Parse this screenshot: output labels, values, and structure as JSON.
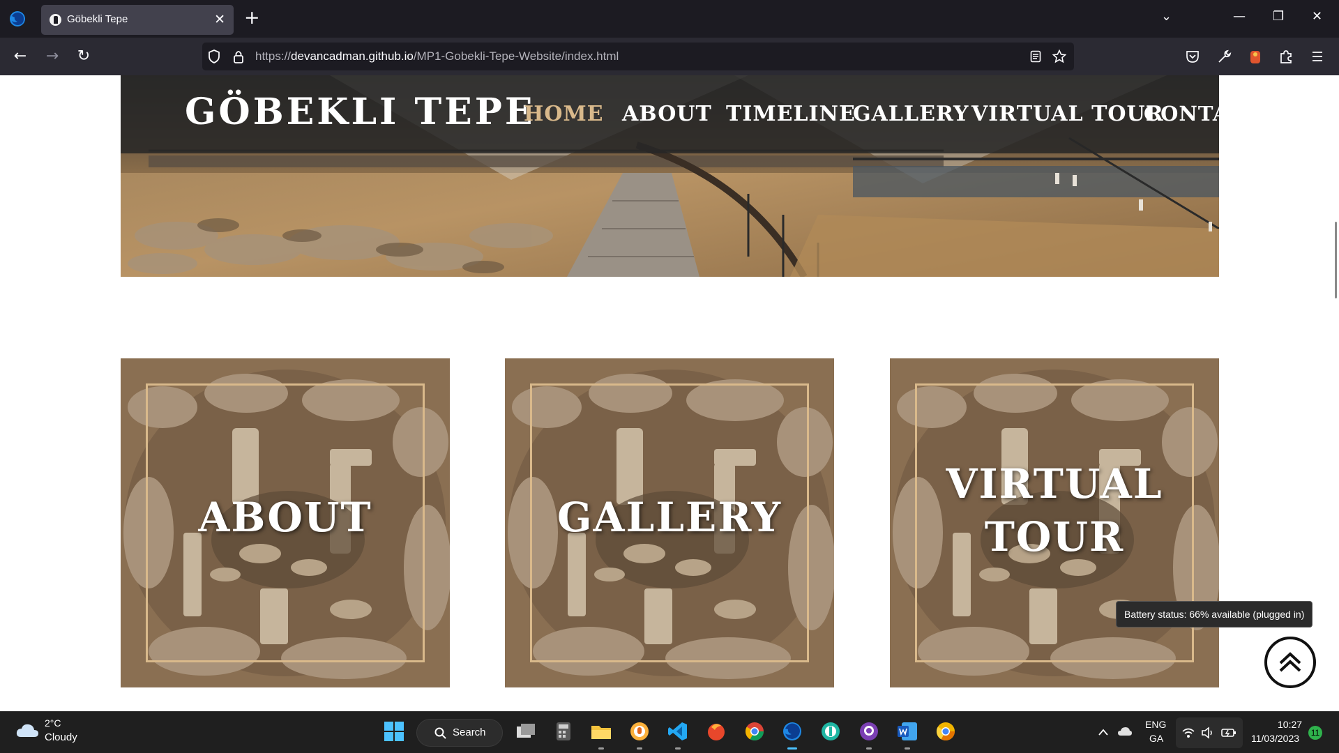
{
  "browser": {
    "tab_title": "Göbekli Tepe",
    "tab_close": "✕",
    "new_tab": "+",
    "url_prefix": "https://",
    "url_host": "devancadman.github.io",
    "url_path": "/MP1-Gobekli-Tepe-Website/index.html",
    "window_controls": {
      "minimize": "—",
      "restore": "❐",
      "close": "✕",
      "list_tabs": "⌄"
    }
  },
  "site": {
    "logo": "GÖBEKLI TEPE",
    "nav": [
      {
        "label": "HOME",
        "active": true
      },
      {
        "label": "ABOUT",
        "active": false
      },
      {
        "label": "TIMELINE",
        "active": false
      },
      {
        "label": "GALLERY",
        "active": false
      },
      {
        "label": "VIRTUAL TOUR",
        "active": false
      },
      {
        "label": "CONTACT",
        "active": false
      }
    ],
    "cards": [
      {
        "line1": "ABOUT",
        "line2": ""
      },
      {
        "line1": "GALLERY",
        "line2": ""
      },
      {
        "line1": "VIRTUAL",
        "line2": "TOUR"
      }
    ],
    "accent_color": "#d9b98b"
  },
  "tooltip": "Battery status: 66% available (plugged in)",
  "taskbar": {
    "weather_temp": "2°C",
    "weather_condition": "Cloudy",
    "search_label": "Search",
    "lang_line1": "ENG",
    "lang_line2": "GA",
    "time": "10:27",
    "date": "11/03/2023",
    "notification_count": "11",
    "apps": [
      "start-icon",
      "task-view-icon",
      "calculator-icon",
      "file-explorer-icon",
      "brave-icon",
      "vscode-icon",
      "firefox-dev-icon",
      "chrome-icon",
      "firefox-icon",
      "gitkraken-icon",
      "github-desktop-icon",
      "word-icon",
      "chrome-canary-icon"
    ]
  }
}
